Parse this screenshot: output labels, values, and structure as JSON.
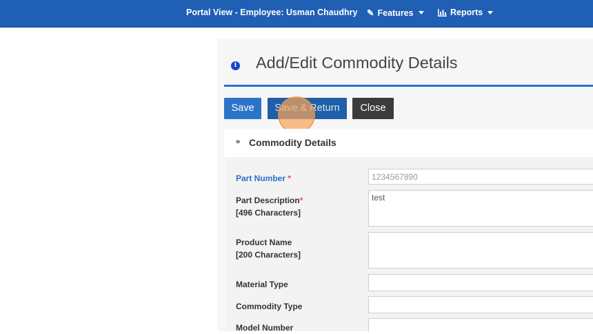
{
  "navbar": {
    "portal_view": "Portal View - Employee: Usman Chaudhry",
    "features_label": "Features",
    "reports_label": "Reports"
  },
  "page": {
    "title": "Add/Edit Commodity Details"
  },
  "toolbar": {
    "save_label": "Save",
    "save_return_label": "Save & Return",
    "close_label": "Close"
  },
  "section": {
    "title": "Commodity Details"
  },
  "form": {
    "part_number_label": "Part Number",
    "part_number_value": "1234567890",
    "part_description_label": "Part Description",
    "part_description_limit": "[496 Characters]",
    "part_description_value": "test",
    "product_name_label": "Product Name",
    "product_name_limit": "[200 Characters]",
    "product_name_value": "",
    "material_type_label": "Material Type",
    "material_type_value": "",
    "commodity_type_label": "Commodity Type",
    "commodity_type_value": "",
    "model_number_label": "Model Number",
    "model_number_value": "",
    "required_marker": "*"
  },
  "colors": {
    "navbar": "#1f5fb4",
    "primary_button": "#2b73c6",
    "close_button": "#3b3b3b",
    "label_blue": "#2a6fc9",
    "required_red": "#d9534f"
  }
}
